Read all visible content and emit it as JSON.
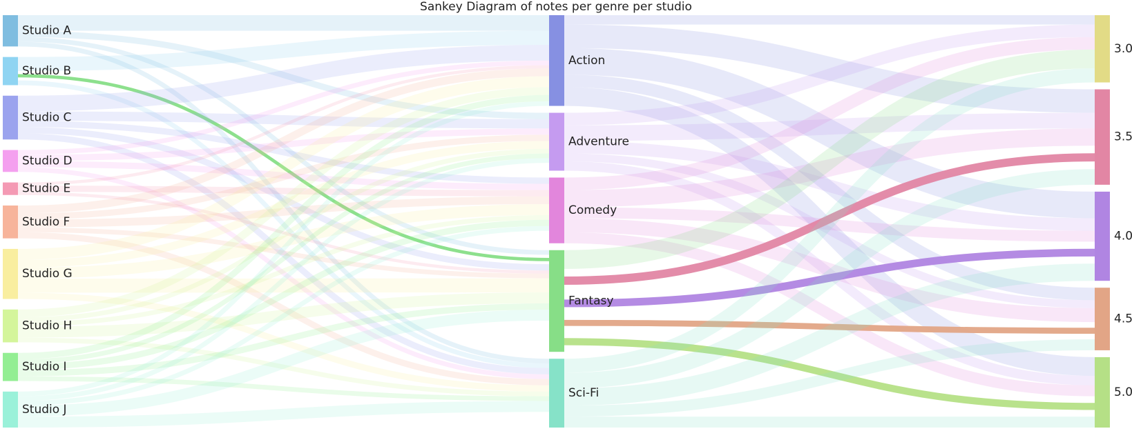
{
  "chart_data": {
    "type": "sankey",
    "title": "Sankey Diagram of notes per genre per studio",
    "columns": [
      [
        "Studio A",
        "Studio B",
        "Studio C",
        "Studio D",
        "Studio E",
        "Studio F",
        "Studio G",
        "Studio H",
        "Studio I",
        "Studio J"
      ],
      [
        "Action",
        "Adventure",
        "Comedy",
        "Fantasy",
        "Sci-Fi"
      ],
      [
        "3.0",
        "3.5",
        "4.0",
        "4.5",
        "5.0"
      ]
    ],
    "colors": {
      "Studio A": "#7fbde0",
      "Studio B": "#8fd4f2",
      "Studio C": "#9ba3ee",
      "Studio D": "#f4a0ef",
      "Studio E": "#f49ab4",
      "Studio F": "#f7b49b",
      "Studio G": "#f9ee9f",
      "Studio H": "#d4f59b",
      "Studio I": "#93ee93",
      "Studio J": "#9af1d9",
      "Action": "#8690e2",
      "Adventure": "#c59bf0",
      "Comedy": "#e286dc",
      "Fantasy": "#87de87",
      "Sci-Fi": "#86e2c8",
      "3.0": "#e2db86",
      "3.5": "#e286a4",
      "4.0": "#b085e2",
      "4.5": "#e2a586",
      "5.0": "#b5e086"
    },
    "links": [
      {
        "source": "Studio A",
        "target": "Action",
        "value": 2
      },
      {
        "source": "Studio A",
        "target": "Adventure",
        "value": 0.8
      },
      {
        "source": "Studio A",
        "target": "Fantasy",
        "value": 0.6
      },
      {
        "source": "Studio A",
        "target": "Sci-Fi",
        "value": 0.6
      },
      {
        "source": "Studio B",
        "target": "Action",
        "value": 1.8
      },
      {
        "source": "Studio B",
        "target": "Fantasy",
        "value": 1.2
      },
      {
        "source": "Studio B",
        "target": "Sci-Fi",
        "value": 0.6
      },
      {
        "source": "Studio C",
        "target": "Action",
        "value": 2
      },
      {
        "source": "Studio C",
        "target": "Adventure",
        "value": 1.2
      },
      {
        "source": "Studio C",
        "target": "Comedy",
        "value": 0.8
      },
      {
        "source": "Studio C",
        "target": "Fantasy",
        "value": 0.8
      },
      {
        "source": "Studio C",
        "target": "Sci-Fi",
        "value": 0.8
      },
      {
        "source": "Studio D",
        "target": "Action",
        "value": 0.6
      },
      {
        "source": "Studio D",
        "target": "Adventure",
        "value": 0.8
      },
      {
        "source": "Studio D",
        "target": "Comedy",
        "value": 0.8
      },
      {
        "source": "Studio D",
        "target": "Sci-Fi",
        "value": 0.6
      },
      {
        "source": "Studio E",
        "target": "Action",
        "value": 0.4
      },
      {
        "source": "Studio E",
        "target": "Comedy",
        "value": 0.8
      },
      {
        "source": "Studio E",
        "target": "Fantasy",
        "value": 0.4
      },
      {
        "source": "Studio F",
        "target": "Action",
        "value": 1
      },
      {
        "source": "Studio F",
        "target": "Adventure",
        "value": 0.8
      },
      {
        "source": "Studio F",
        "target": "Comedy",
        "value": 1
      },
      {
        "source": "Studio F",
        "target": "Fantasy",
        "value": 0.6
      },
      {
        "source": "Studio F",
        "target": "Sci-Fi",
        "value": 0.8
      },
      {
        "source": "Studio G",
        "target": "Action",
        "value": 1.4
      },
      {
        "source": "Studio G",
        "target": "Adventure",
        "value": 1
      },
      {
        "source": "Studio G",
        "target": "Comedy",
        "value": 1.4
      },
      {
        "source": "Studio G",
        "target": "Fantasy",
        "value": 1.8
      },
      {
        "source": "Studio G",
        "target": "Sci-Fi",
        "value": 0.8
      },
      {
        "source": "Studio H",
        "target": "Action",
        "value": 1
      },
      {
        "source": "Studio H",
        "target": "Adventure",
        "value": 0.6
      },
      {
        "source": "Studio H",
        "target": "Comedy",
        "value": 0.6
      },
      {
        "source": "Studio H",
        "target": "Fantasy",
        "value": 1.4
      },
      {
        "source": "Studio H",
        "target": "Sci-Fi",
        "value": 0.6
      },
      {
        "source": "Studio I",
        "target": "Action",
        "value": 0.8
      },
      {
        "source": "Studio I",
        "target": "Adventure",
        "value": 0.6
      },
      {
        "source": "Studio I",
        "target": "Comedy",
        "value": 0.8
      },
      {
        "source": "Studio I",
        "target": "Fantasy",
        "value": 0.8
      },
      {
        "source": "Studio I",
        "target": "Sci-Fi",
        "value": 0.6
      },
      {
        "source": "Studio J",
        "target": "Action",
        "value": 0.6
      },
      {
        "source": "Studio J",
        "target": "Adventure",
        "value": 0.6
      },
      {
        "source": "Studio J",
        "target": "Comedy",
        "value": 0.6
      },
      {
        "source": "Studio J",
        "target": "Fantasy",
        "value": 1.4
      },
      {
        "source": "Studio J",
        "target": "Sci-Fi",
        "value": 1.4
      },
      {
        "source": "Action",
        "target": "3.0",
        "value": 1.2
      },
      {
        "source": "Action",
        "target": "3.5",
        "value": 3
      },
      {
        "source": "Action",
        "target": "4.0",
        "value": 3.4
      },
      {
        "source": "Action",
        "target": "4.5",
        "value": 1.6
      },
      {
        "source": "Action",
        "target": "5.0",
        "value": 2.4
      },
      {
        "source": "Adventure",
        "target": "3.0",
        "value": 1.6
      },
      {
        "source": "Adventure",
        "target": "3.5",
        "value": 2
      },
      {
        "source": "Adventure",
        "target": "4.0",
        "value": 1.6
      },
      {
        "source": "Adventure",
        "target": "4.5",
        "value": 1
      },
      {
        "source": "Adventure",
        "target": "5.0",
        "value": 1.2
      },
      {
        "source": "Comedy",
        "target": "3.0",
        "value": 1.6
      },
      {
        "source": "Comedy",
        "target": "3.5",
        "value": 2.2
      },
      {
        "source": "Comedy",
        "target": "4.0",
        "value": 1.4
      },
      {
        "source": "Comedy",
        "target": "4.5",
        "value": 1.8
      },
      {
        "source": "Comedy",
        "target": "5.0",
        "value": 1.4
      },
      {
        "source": "Fantasy",
        "target": "3.0",
        "value": 2.4
      },
      {
        "source": "Fantasy",
        "target": "3.5",
        "value": 3
      },
      {
        "source": "Fantasy",
        "target": "4.0",
        "value": 2.8
      },
      {
        "source": "Fantasy",
        "target": "4.5",
        "value": 2.2
      },
      {
        "source": "Fantasy",
        "target": "5.0",
        "value": 2.6
      },
      {
        "source": "Sci-Fi",
        "target": "3.0",
        "value": 1.8
      },
      {
        "source": "Sci-Fi",
        "target": "3.5",
        "value": 2
      },
      {
        "source": "Sci-Fi",
        "target": "4.0",
        "value": 2.2
      },
      {
        "source": "Sci-Fi",
        "target": "4.5",
        "value": 1.4
      },
      {
        "source": "Sci-Fi",
        "target": "5.0",
        "value": 1.4
      }
    ],
    "highlighted_path": [
      "Studio B",
      "Fantasy",
      "3.5",
      "4.0",
      "4.5",
      "5.0"
    ]
  }
}
